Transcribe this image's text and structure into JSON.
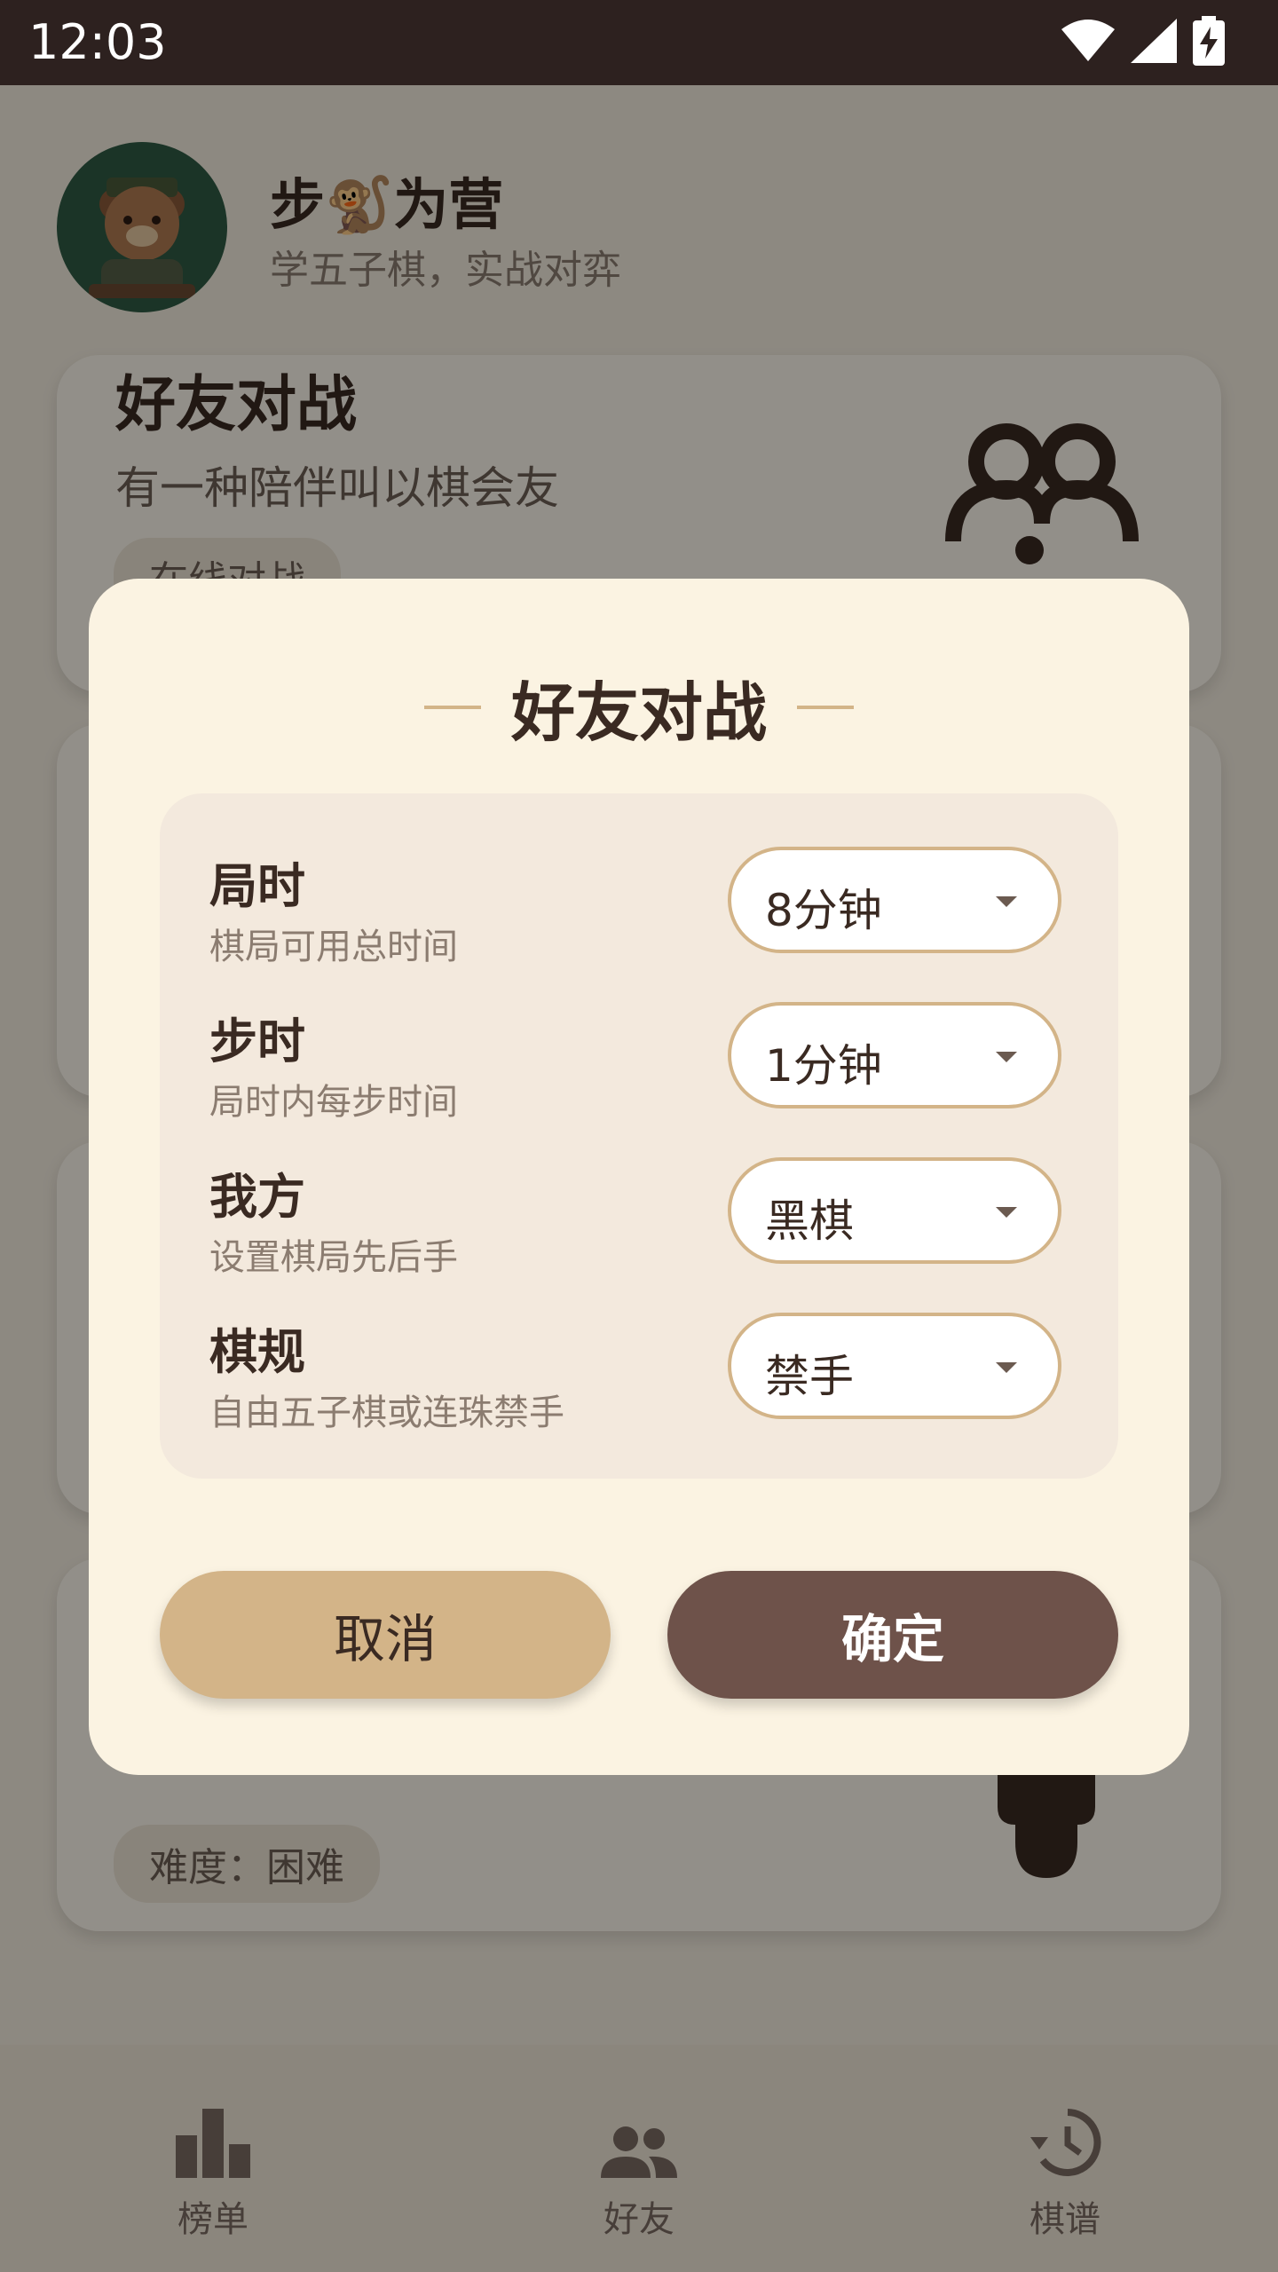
{
  "status_bar": {
    "time": "12:03"
  },
  "header": {
    "title": "步🐒为营",
    "subtitle": "学五子棋，实战对弈"
  },
  "cards": [
    {
      "title": "好友对战",
      "subtitle": "有一种陪伴叫以棋会友",
      "chip": "在线对战"
    },
    {
      "chip": "难度：困难"
    }
  ],
  "bottom_nav": [
    {
      "label": "榜单",
      "icon": "leaderboard-icon"
    },
    {
      "label": "好友",
      "icon": "friends-icon"
    },
    {
      "label": "棋谱",
      "icon": "history-icon"
    }
  ],
  "dialog": {
    "title": "好友对战",
    "rows": [
      {
        "label": "局时",
        "desc": "棋局可用总时间",
        "value": "8分钟"
      },
      {
        "label": "步时",
        "desc": "局时内每步时间",
        "value": "1分钟"
      },
      {
        "label": "我方",
        "desc": "设置棋局先后手",
        "value": "黑棋"
      },
      {
        "label": "棋规",
        "desc": "自由五子棋或连珠禁手",
        "value": "禁手"
      }
    ],
    "cancel_label": "取消",
    "confirm_label": "确定"
  },
  "colors": {
    "accent_tan": "#d3b488",
    "accent_brown": "#6e524a",
    "text_dark": "#3a2a22",
    "dialog_bg": "#fbf3e2"
  }
}
